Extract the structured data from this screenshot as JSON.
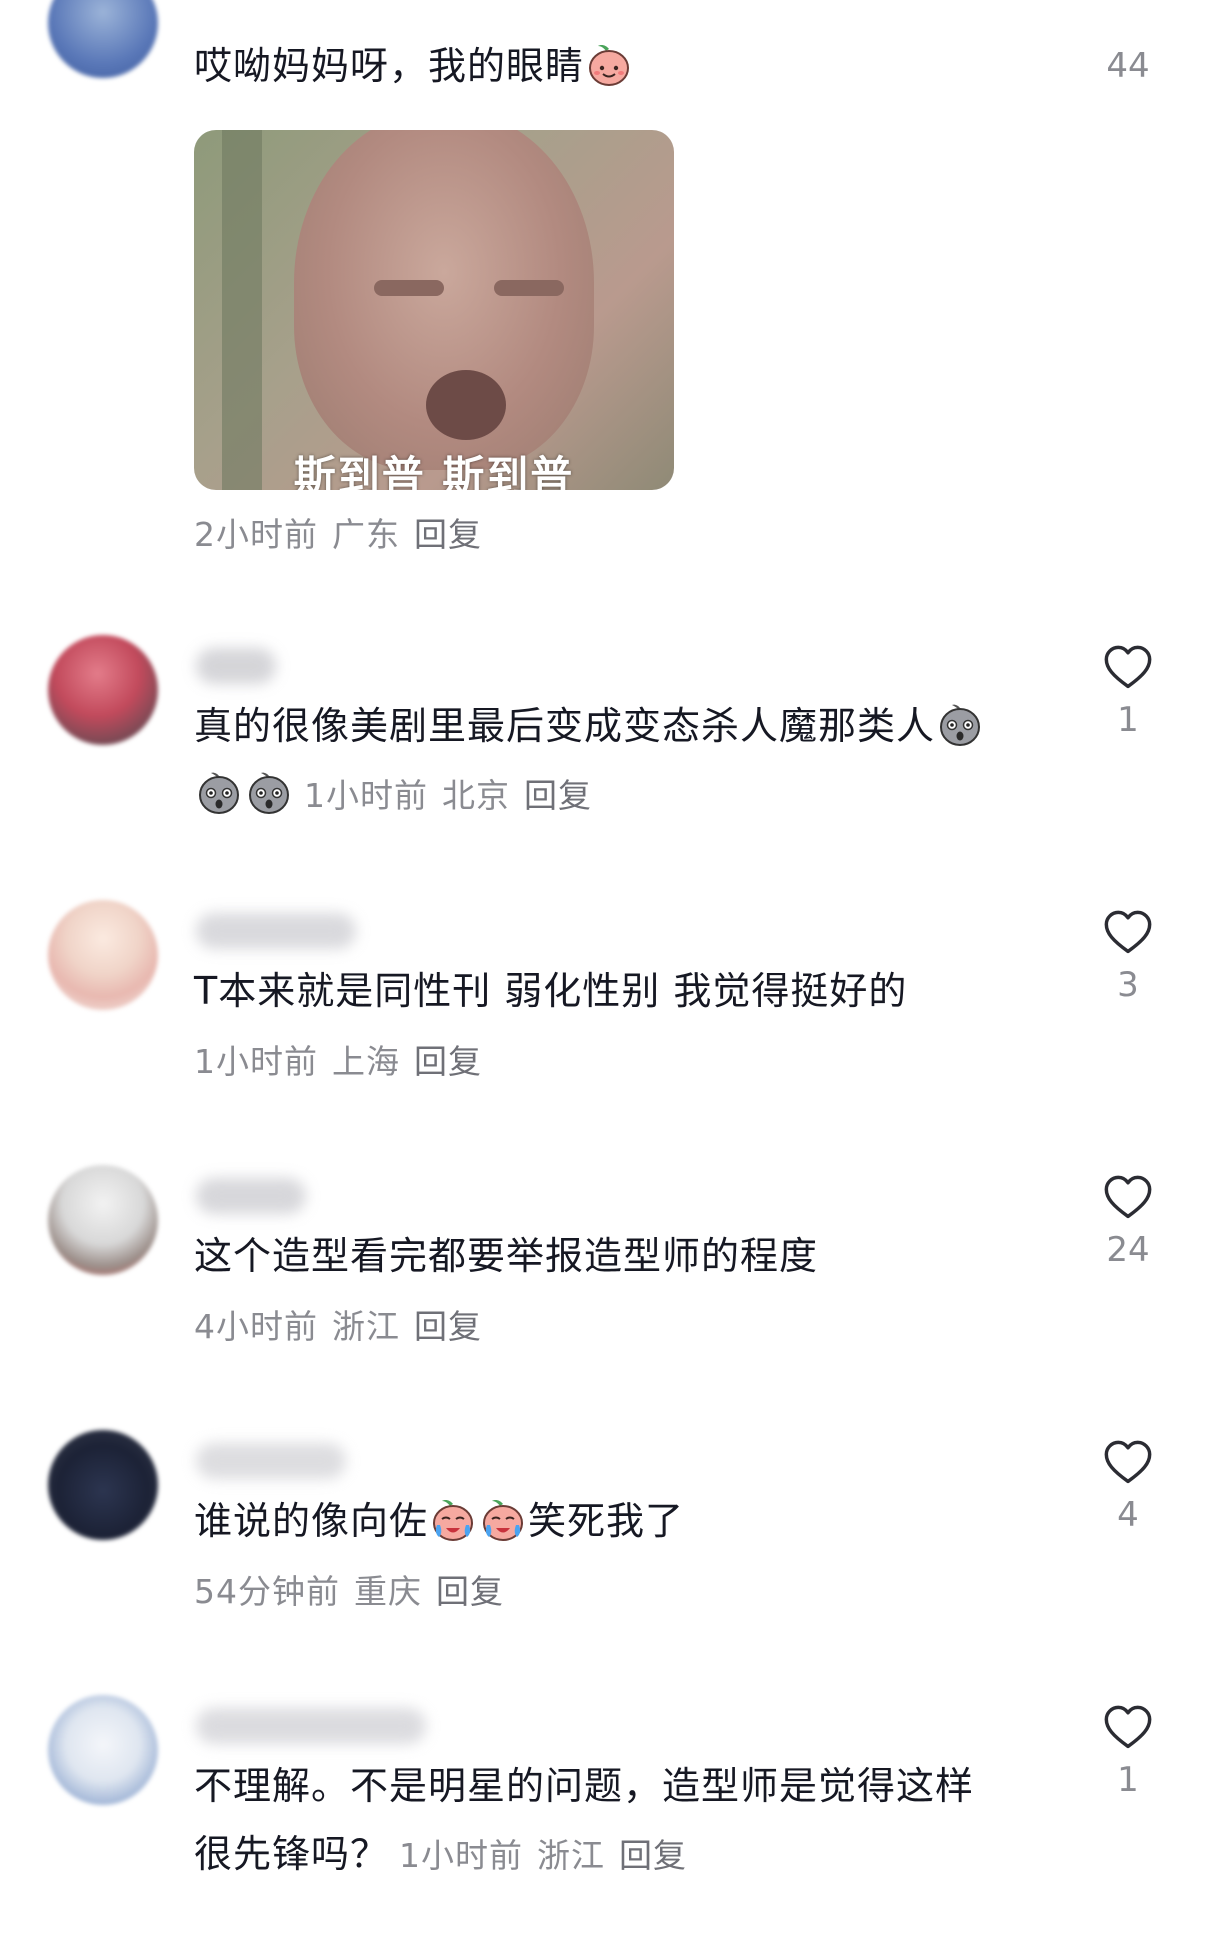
{
  "comments": [
    {
      "text": "哎呦妈妈呀，我的眼睛",
      "gif_caption": "斯到普 斯到普",
      "time": "2小时前",
      "location": "广东",
      "reply": "回复",
      "likes": "44"
    },
    {
      "text": "真的很像美剧里最后变成变态杀人魔那类人",
      "time": "1小时前",
      "location": "北京",
      "reply": "回复",
      "likes": "1"
    },
    {
      "text": "T本来就是同性刊 弱化性别 我觉得挺好的",
      "time": "1小时前",
      "location": "上海",
      "reply": "回复",
      "likes": "3"
    },
    {
      "text": "这个造型看完都要举报造型师的程度",
      "time": "4小时前",
      "location": "浙江",
      "reply": "回复",
      "likes": "24"
    },
    {
      "text_before": "谁说的像向佐",
      "text_after": "笑死我了",
      "time": "54分钟前",
      "location": "重庆",
      "reply": "回复",
      "likes": "4"
    },
    {
      "text_line1": "不理解。不是明星的问题，造型师是觉得这样",
      "text_line2": "很先锋吗？",
      "time": "1小时前",
      "location": "浙江",
      "reply": "回复",
      "likes": "1"
    }
  ],
  "colors": {
    "text": "#161823",
    "meta": "#8a8b91",
    "heart_stroke": "#2b2c33"
  }
}
